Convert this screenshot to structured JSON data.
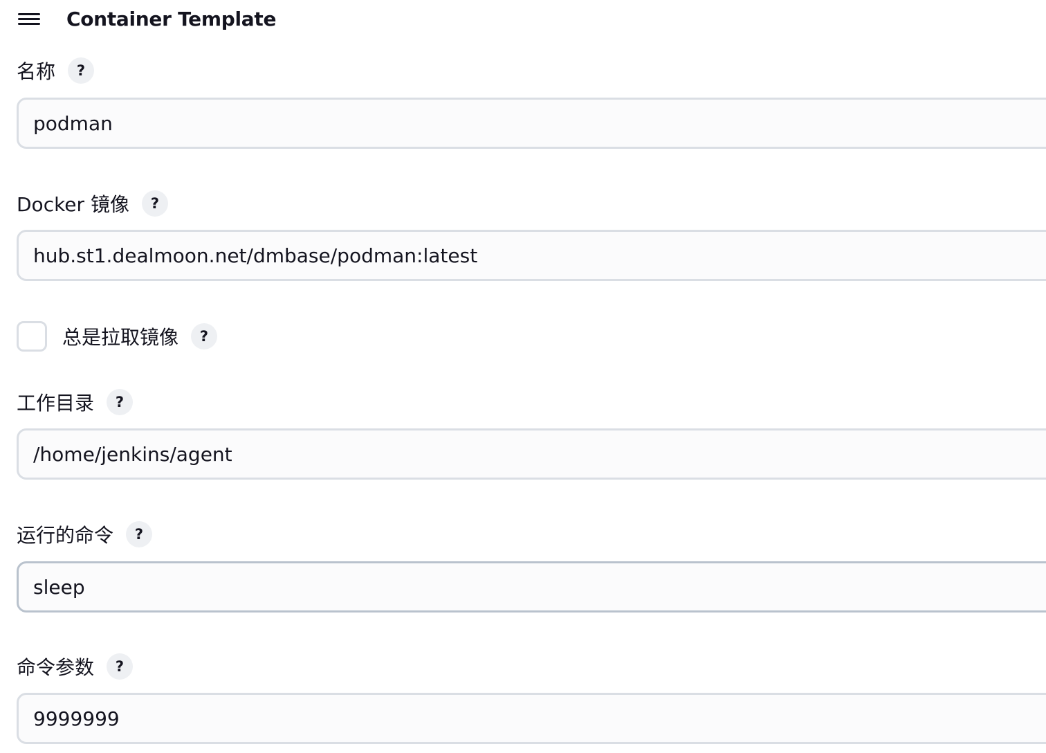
{
  "header": {
    "menu_icon": "hamburger-menu-icon",
    "title": "Container Template"
  },
  "fields": {
    "name": {
      "label": "名称",
      "value": "podman"
    },
    "image": {
      "label": "Docker 镜像",
      "value": "hub.st1.dealmoon.net/dmbase/podman:latest"
    },
    "always_pull": {
      "label": "总是拉取镜像",
      "checked": false
    },
    "working_dir": {
      "label": "工作目录",
      "value": "/home/jenkins/agent"
    },
    "command": {
      "label": "运行的命令",
      "value": "sleep"
    },
    "args": {
      "label": "命令参数",
      "value": "9999999"
    }
  },
  "help_glyph": "?"
}
